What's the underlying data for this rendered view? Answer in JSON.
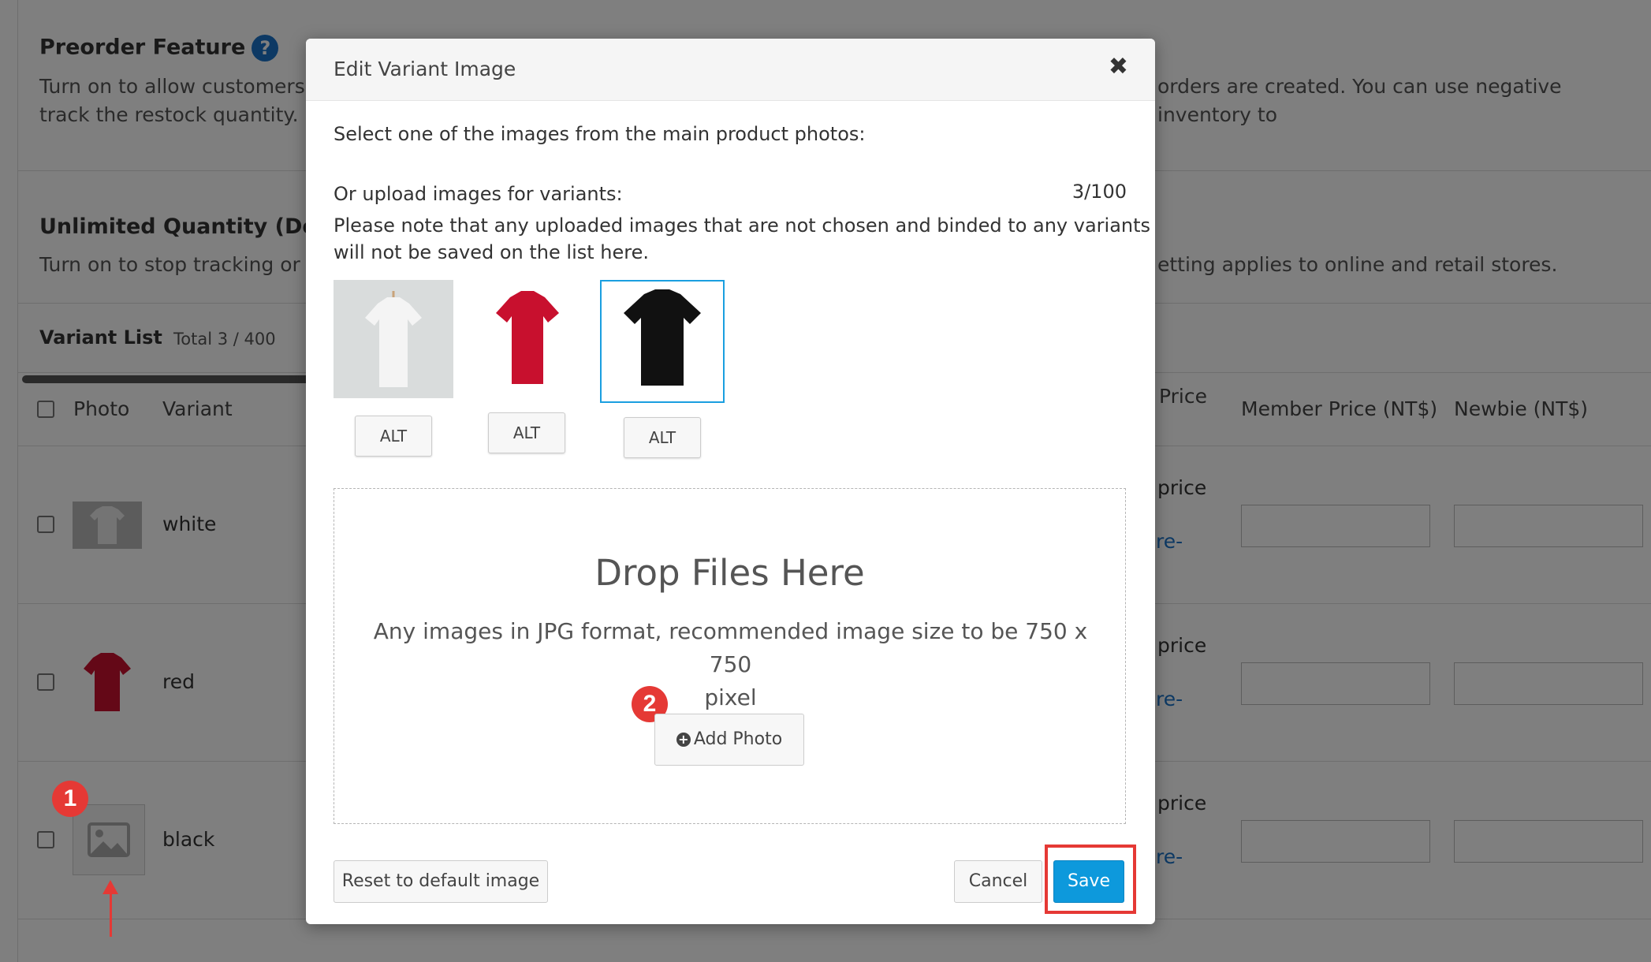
{
  "background": {
    "preorder": {
      "title": "Preorder Feature",
      "help_icon": "?",
      "desc_left_line1": "Turn on to allow customers t",
      "desc_right_line1": "orders are created. You can use negative inventory to",
      "desc_line2": "track the restock quantity."
    },
    "unlimited": {
      "title": "Unlimited Quantity (Do",
      "desc_left": "Turn on to stop tracking or re",
      "desc_right": "etting applies to online and retail stores."
    },
    "variant_list": {
      "title": "Variant List",
      "total": "Total 3 / 400"
    },
    "table_headers": {
      "photo": "Photo",
      "variant": "Variant",
      "price": "Price",
      "member_price": "Member Price (NT$)",
      "newbie": "Newbie (NT$)"
    },
    "rows": [
      {
        "variant": "white",
        "price": "price",
        "link": "re-"
      },
      {
        "variant": "red",
        "price": "price",
        "link": "re-"
      },
      {
        "variant": "black",
        "price": "price",
        "link": "re-"
      }
    ]
  },
  "annotations": {
    "badge1": "1",
    "badge2": "2"
  },
  "modal": {
    "title": "Edit Variant Image",
    "close": "✖",
    "select_text": "Select one of the images from the main product photos:",
    "upload_text": "Or upload images for variants:",
    "upload_count": "3/100",
    "note_line1": "Please note that any uploaded images that are not chosen and binded to any variants",
    "note_line2": "will not be saved on the list here.",
    "images": [
      {
        "color": "white",
        "alt_label": "ALT"
      },
      {
        "color": "red",
        "alt_label": "ALT"
      },
      {
        "color": "black",
        "alt_label": "ALT",
        "selected": true
      }
    ],
    "dropzone": {
      "title": "Drop Files Here",
      "desc_line1": "Any images in JPG format, recommended image size to be 750 x 750",
      "desc_line2": "pixel",
      "add_photo": "Add Photo"
    },
    "footer": {
      "reset": "Reset to default image",
      "cancel": "Cancel",
      "save": "Save"
    }
  },
  "colors": {
    "accent": "#0d99dc",
    "annotation": "#e53935",
    "tshirt_red": "#c8102e",
    "tshirt_black": "#111111"
  }
}
